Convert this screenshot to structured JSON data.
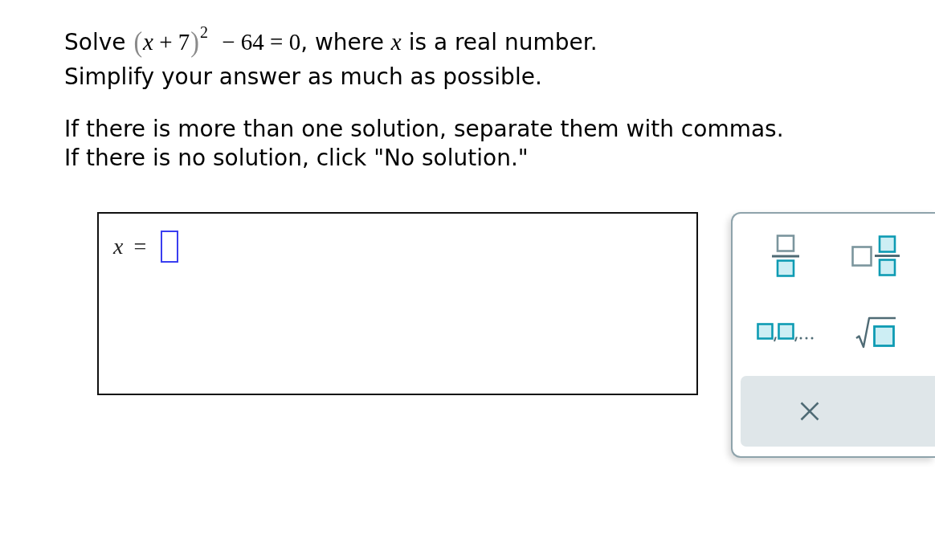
{
  "question": {
    "segments": [
      {
        "kind": "text",
        "text": "Solve "
      },
      {
        "kind": "paren",
        "text": "("
      },
      {
        "kind": "math",
        "text": "*x* + 7"
      },
      {
        "kind": "paren",
        "text": ")"
      },
      {
        "kind": "math",
        "text": "$^{2}$ − 64 = 0"
      },
      {
        "kind": "text",
        "text": ", where "
      },
      {
        "kind": "variable",
        "text": "x"
      },
      {
        "kind": "text",
        "text": " is a real number."
      }
    ]
  },
  "instructions": [
    "Simplify your answer as much as possible."
  ],
  "notes": [
    "If there is more than one solution, separate them with commas.",
    "If there is no solution, click \"No solution.\""
  ],
  "answer": {
    "label": "*x* =",
    "field": {
      "active": true
    }
  },
  "palette": {
    "templates": [
      {
        "kind": "fraction"
      },
      {
        "kind": "mixed_number"
      },
      {
        "kind": "list"
      },
      {
        "kind": "square_root"
      }
    ],
    "actions": [
      {
        "kind": "clear"
      }
    ]
  }
}
